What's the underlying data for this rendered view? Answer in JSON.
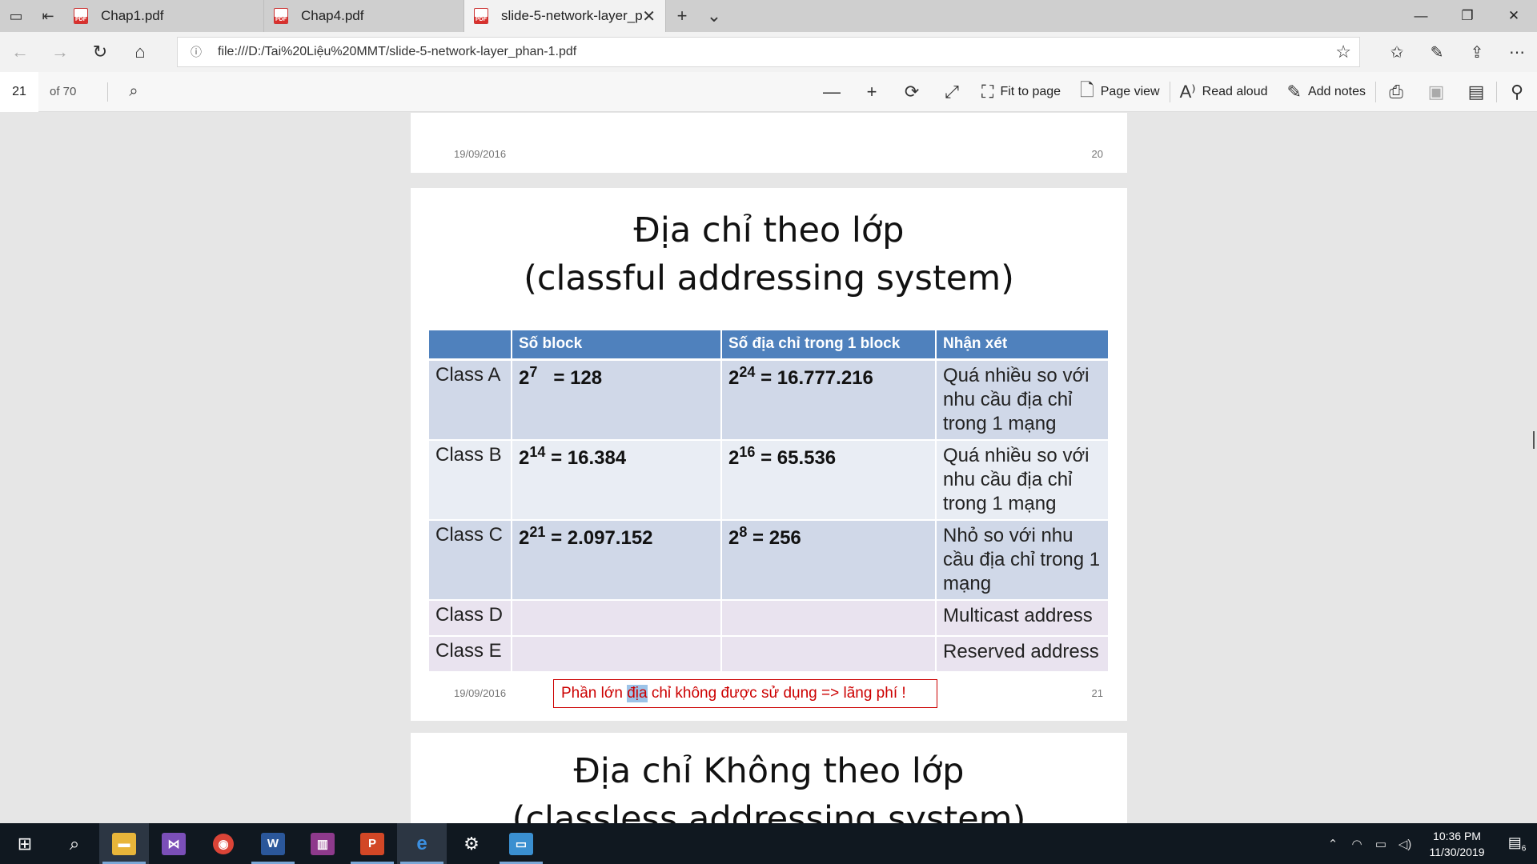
{
  "tabs": [
    {
      "label": "Chap1.pdf"
    },
    {
      "label": "Chap4.pdf"
    },
    {
      "label": "slide-5-network-layer_p"
    }
  ],
  "address": {
    "url": "file:///D:/Tai%20Liệu%20MMT/slide-5-network-layer_phan-1.pdf"
  },
  "pdf_toolbar": {
    "page_number": "21",
    "page_of": "of 70",
    "fit_to_page": "Fit to page",
    "page_view": "Page view",
    "read_aloud": "Read aloud",
    "add_notes": "Add notes"
  },
  "page20": {
    "date": "19/09/2016",
    "number": "20"
  },
  "page21": {
    "title_line1": "Địa chỉ theo lớp",
    "title_line2": "(classful addressing system)",
    "headers": [
      "",
      "Số  block",
      "Số địa chỉ trong 1 block",
      "Nhận xét"
    ],
    "rows": [
      {
        "name": "Class A",
        "blocks_exp": "7",
        "blocks_val": "= 128",
        "addr_exp": "24",
        "addr_val": "= 16.777.216",
        "note": "Quá nhiều so với nhu cầu địa chỉ trong 1 mạng"
      },
      {
        "name": "Class B",
        "blocks_exp": "14",
        "blocks_val": "= 16.384",
        "addr_exp": "16",
        "addr_val": "=  65.536",
        "note": "Quá nhiều so với nhu cầu địa chỉ trong 1 mạng"
      },
      {
        "name": "Class C",
        "blocks_exp": "21",
        "blocks_val": "=  2.097.152",
        "addr_exp": "8",
        "addr_val": "=  256",
        "note": "Nhỏ so với nhu cầu địa chỉ trong 1 mạng"
      },
      {
        "name": "Class D",
        "note": "Multicast address"
      },
      {
        "name": "Class E",
        "note": "Reserved address"
      }
    ],
    "base": "2",
    "callout_pre": "Phần lớn ",
    "callout_hl": "địa",
    "callout_post": " chỉ không được sử dụng => lãng phí !",
    "date": "19/09/2016",
    "number": "21"
  },
  "page22": {
    "title_line1": "Địa chỉ Không theo lớp",
    "title_line2": "(classless addressing system)"
  },
  "clock": {
    "time": "10:36 PM",
    "date": "11/30/2019"
  },
  "notification_count": "6"
}
